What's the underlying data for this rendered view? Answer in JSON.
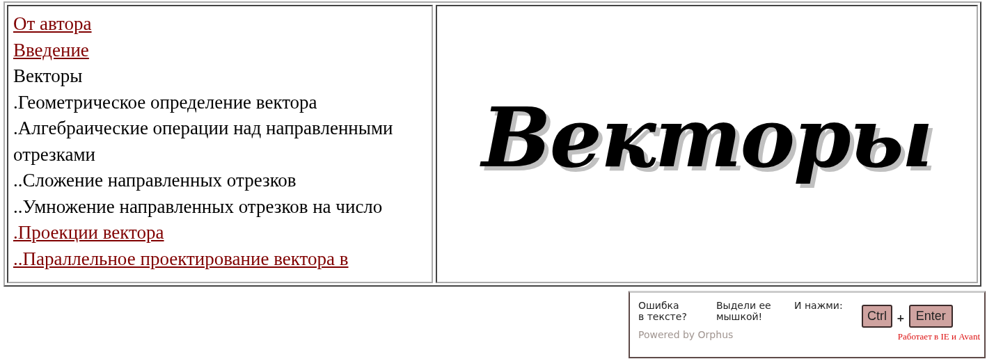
{
  "contents": [
    {
      "label": "От автора",
      "kind": "link"
    },
    {
      "label": "Введение",
      "kind": "link"
    },
    {
      "label": "Векторы",
      "kind": "text"
    },
    {
      "label": ".Геометрическое определение вектора",
      "kind": "text"
    },
    {
      "label": ".Алгебраические операции над направленными отрезками",
      "kind": "text"
    },
    {
      "label": "..Сложение направленных отрезков",
      "kind": "text"
    },
    {
      "label": "..Умножение направленных отрезков на число",
      "kind": "text"
    },
    {
      "label": ".Проекции вектора",
      "kind": "link"
    },
    {
      "label": "..Параллельное проектирование вектора в",
      "kind": "link"
    }
  ],
  "heading": "Векторы",
  "orphus": {
    "col1": [
      "Ошибка",
      "в тексте?"
    ],
    "col2": [
      "Выдели ее",
      "мышкой!"
    ],
    "prompt": "И нажми:",
    "keys": [
      "Ctrl",
      "Enter"
    ],
    "plus": "+",
    "powered": "Powered by Orphus",
    "note": "Работает в IE и Avant"
  }
}
